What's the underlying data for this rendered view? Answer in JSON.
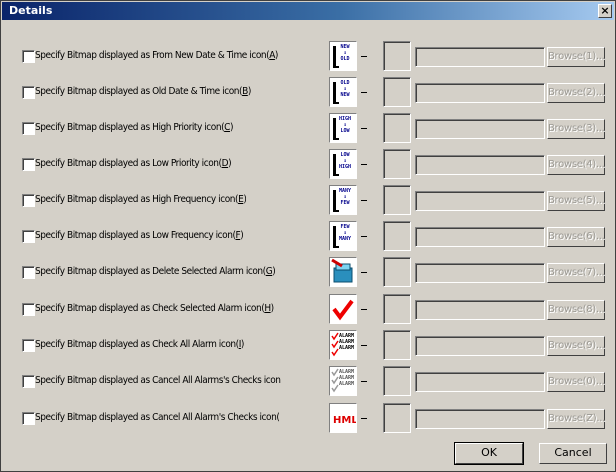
{
  "window": {
    "title": "Details",
    "close_label": "×"
  },
  "rows": [
    {
      "label": "Specify Bitmap displayed as From New Date & Time icon(",
      "hotkey": "A",
      "suffix": ")",
      "browse": "Browse(1)...",
      "icon": "new-old-icon",
      "icon_text": [
        "NEW",
        "↕",
        "OLD"
      ]
    },
    {
      "label": "Specify Bitmap displayed as Old Date & Time icon(",
      "hotkey": "B",
      "suffix": ")",
      "browse": "Browse(2)...",
      "icon": "old-new-icon",
      "icon_text": [
        "OLD",
        "↕",
        "NEW"
      ]
    },
    {
      "label": "Specify Bitmap displayed as High Priority icon(",
      "hotkey": "C",
      "suffix": ")",
      "browse": "Browse(3)...",
      "icon": "high-low-icon",
      "icon_text": [
        "HIGH",
        "↕",
        "LOW"
      ]
    },
    {
      "label": "Specify Bitmap displayed as Low Priority icon(",
      "hotkey": "D",
      "suffix": ")",
      "browse": "Browse(4)...",
      "icon": "low-high-icon",
      "icon_text": [
        "LOW",
        "↕",
        "HIGH"
      ]
    },
    {
      "label": "Specify Bitmap displayed as High Frequency icon(",
      "hotkey": "E",
      "suffix": ")",
      "browse": "Browse(5)...",
      "icon": "many-few-icon",
      "icon_text": [
        "MANY",
        "↕",
        "FEW"
      ]
    },
    {
      "label": "Specify Bitmap displayed as Low Frequency icon(",
      "hotkey": "F",
      "suffix": ")",
      "browse": "Browse(6)...",
      "icon": "few-many-icon",
      "icon_text": [
        "FEW",
        "↕",
        "MANY"
      ]
    },
    {
      "label": "Specify Bitmap displayed as Delete Selected Alarm icon(",
      "hotkey": "G",
      "suffix": ")",
      "browse": "Browse(7)...",
      "icon": "delete-alarm-icon",
      "icon_text": []
    },
    {
      "label": "Specify Bitmap displayed as Check Selected Alarm icon(",
      "hotkey": "H",
      "suffix": ")",
      "browse": "Browse(8)...",
      "icon": "check-alarm-icon",
      "icon_text": []
    },
    {
      "label": "Specify Bitmap displayed as Check All Alarm icon(",
      "hotkey": "I",
      "suffix": ")",
      "browse": "Browse(9)...",
      "icon": "check-all-alarm-icon",
      "icon_text": [
        "ALARM",
        "ALARM",
        "ALARM"
      ]
    },
    {
      "label": "Specify Bitmap displayed as Cancel All Alarms's Checks icon",
      "hotkey": "",
      "suffix": "",
      "browse": "Browse(0)...",
      "icon": "cancel-all-checks-icon",
      "icon_text": [
        "ALARM",
        "ALARM",
        "ALARM"
      ]
    },
    {
      "label": "Specify Bitmap displayed as Cancel All Alarm's Checks icon(",
      "hotkey": "",
      "suffix": "",
      "browse": "Browse(Z)...",
      "icon": "html-icon",
      "icon_text": [
        "HML"
      ]
    }
  ],
  "buttons": {
    "ok": "OK",
    "cancel": "Cancel"
  },
  "colors": {
    "title_start": "#0a246a",
    "title_end": "#a6caf0",
    "face": "#d4d0c8"
  }
}
